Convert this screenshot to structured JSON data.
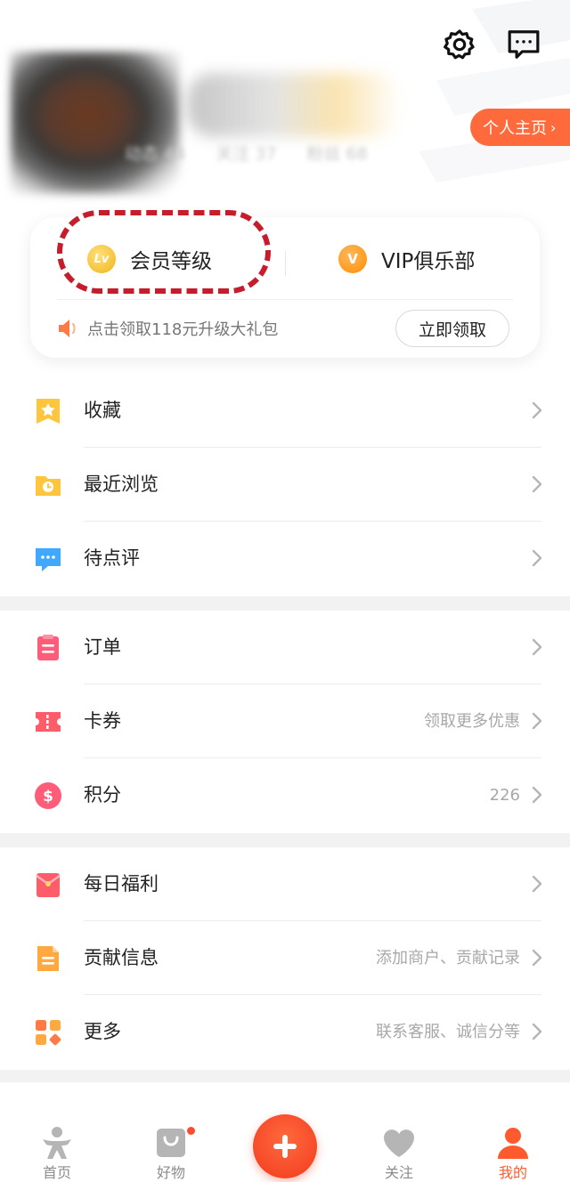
{
  "header": {
    "homepage_button": "个人主页",
    "stats": [
      "动态 44",
      "关注 37",
      "粉丝 68"
    ]
  },
  "membership": {
    "level_label": "会员等级",
    "level_badge": "Lv",
    "vip_label": "VIP俱乐部",
    "vip_badge": "V",
    "gift_text": "点击领取118元升级大礼包",
    "claim_button": "立即领取"
  },
  "groups": [
    {
      "items": [
        {
          "label": "收藏",
          "value": "",
          "icon": "star-bookmark-icon"
        },
        {
          "label": "最近浏览",
          "value": "",
          "icon": "history-folder-icon"
        },
        {
          "label": "待点评",
          "value": "",
          "icon": "comment-icon"
        }
      ]
    },
    {
      "items": [
        {
          "label": "订单",
          "value": "",
          "icon": "order-clipboard-icon"
        },
        {
          "label": "卡券",
          "value": "领取更多优惠",
          "icon": "coupon-icon"
        },
        {
          "label": "积分",
          "value": "226",
          "icon": "points-coin-icon"
        }
      ]
    },
    {
      "items": [
        {
          "label": "每日福利",
          "value": "",
          "icon": "red-envelope-icon"
        },
        {
          "label": "贡献信息",
          "value": "添加商户、贡献记录",
          "icon": "contribution-doc-icon"
        },
        {
          "label": "更多",
          "value": "联系客服、诚信分等",
          "icon": "more-grid-icon"
        }
      ]
    }
  ],
  "tabbar": {
    "tabs": [
      {
        "label": "首页",
        "icon": "home-figure-icon",
        "active": false
      },
      {
        "label": "好物",
        "icon": "shopping-bag-icon",
        "active": false,
        "badge_dot": true
      },
      {
        "label": "关注",
        "icon": "heart-icon",
        "active": false
      },
      {
        "label": "我的",
        "icon": "profile-person-icon",
        "active": true
      }
    ],
    "center_button_icon": "plus-icon"
  },
  "colors": {
    "accent": "#ff5a2e",
    "homepage_button": "#ff6a3d",
    "annotation_ring": "#c61c2c",
    "group_gap": "#f2f2f2"
  }
}
